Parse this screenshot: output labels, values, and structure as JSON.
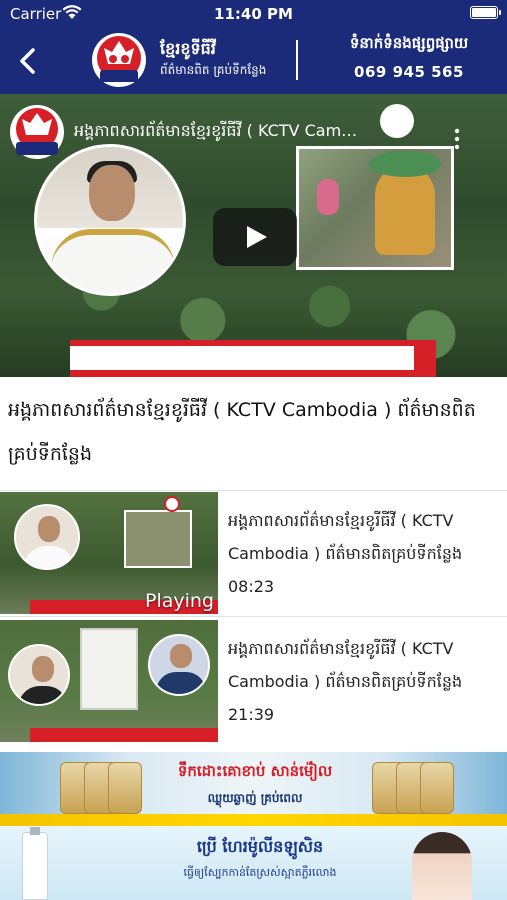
{
  "status_bar": {
    "carrier": "Carrier",
    "time": "11:40 PM"
  },
  "nav": {
    "brand_name": "ខ្មែរខូទីធីវី",
    "brand_tagline": "ព័ត៌មានពិត គ្រប់ទីកន្លែង",
    "logo_text": "ខ្មែរខូទីធីវី",
    "contact_label": "ទំនាក់ទំនងផ្សព្វផ្សាយ",
    "contact_phone": "069 945 565"
  },
  "player": {
    "title": "អង្គភាពសារព័ត៌មានខ្មែរខូរីធីវី ( KCTV Cambodia ) ព័ត៌មានពិតគ្រប់ទីកន្លែង"
  },
  "current_video": {
    "title": "អង្គភាពសារព័ត៌មានខ្មែរខូរីធីវី ( KCTV Cambodia ) ព័ត៌មានពិតគ្រប់ទីកន្លែង"
  },
  "playlist": [
    {
      "title": "អង្គភាពសារព័ត៌មានខ្មែរខូរីធីវី ( KCTV Cambodia ) ព័ត៌មានពិតគ្រប់ទីកន្លែង",
      "duration": "08:23",
      "badge": "Playing"
    },
    {
      "title": "អង្គភាពសារព័ត៌មានខ្មែរខូរីធីវី ( KCTV Cambodia ) ព័ត៌មានពិតគ្រប់ទីកន្លែង",
      "duration": "21:39"
    }
  ],
  "ads": {
    "ad1_title": "ទឹកដោះគោខាប់ សាន់ម៉ៀល",
    "ad1_sub": "ឈ្ងុយឆ្ងាញ់ គ្រប់ពេល",
    "ad2_title": "ប្រើ ហែរម៉ូលីនឡូសិន",
    "ad2_sub": "ធ្វើឲ្យស្បែកកាន់តែស្រស់ស្អាតភ្លឺរលោង"
  },
  "colors": {
    "nav_bg": "#1c2a7a",
    "accent_red": "#d71f27",
    "ribbon_yellow": "#ffd800"
  }
}
